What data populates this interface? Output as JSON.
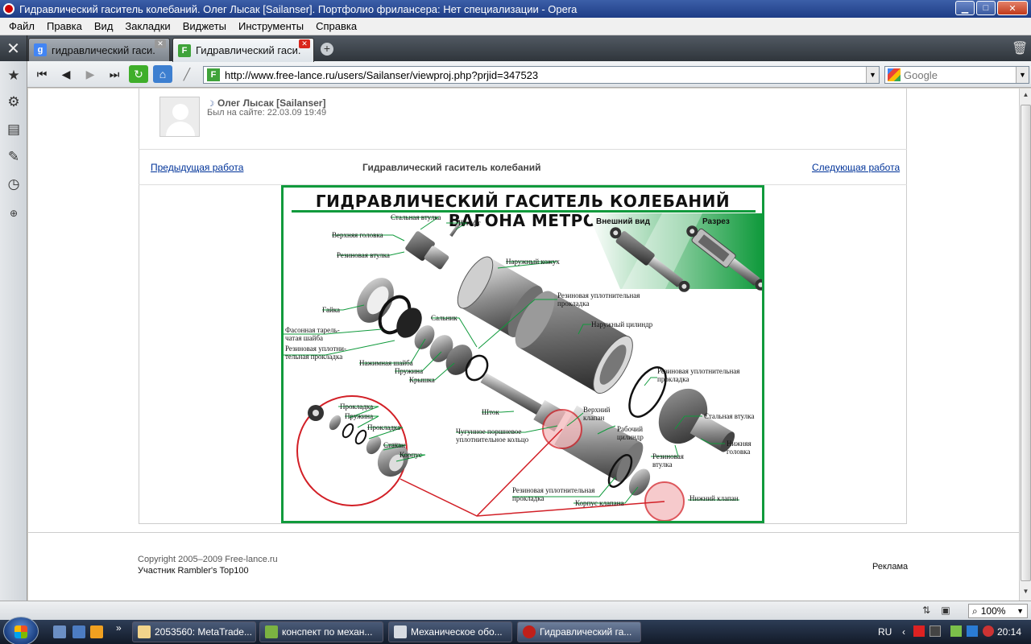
{
  "window": {
    "title": "Гидравлический гаситель колебаний. Олег Лысак [Sailanser]. Портфолио фрилансера: Нет специализации - Opera",
    "min_icon": "minimize-icon",
    "max_icon": "maximize-icon",
    "close_icon": "close-icon"
  },
  "menu": {
    "file": "Файл",
    "edit": "Правка",
    "view": "Вид",
    "bookmarks": "Закладки",
    "widgets": "Виджеты",
    "tools": "Инструменты",
    "help": "Справка"
  },
  "tabs": [
    {
      "label": "гидравлический гаси...",
      "favicon": "google-icon",
      "active": false
    },
    {
      "label": "Гидравлический гаси...",
      "favicon": "free-lance-icon",
      "active": true
    }
  ],
  "address": {
    "url": "http://www.free-lance.ru/users/Sailanser/viewproj.php?prjid=347523",
    "search_placeholder": "Google"
  },
  "profile": {
    "name": "Олег Лысак [Sailanser]",
    "last_seen": "Был на сайте: 22.03.09 19:49"
  },
  "nav": {
    "prev": "Предыдущая работа",
    "title": "Гидравлический гаситель колебаний",
    "next": "Следующая работа"
  },
  "poster": {
    "title": "ГИДРАВЛИЧЕСКИЙ ГАСИТЕЛЬ КОЛЕБАНИЙ ВАГОНА МЕТРО",
    "external_view": "Внешний вид",
    "section": "Разрез",
    "labels": {
      "steel_bushing_top": "Стальная втулка",
      "pin": "Штифт",
      "top_head": "Верхняя головка",
      "rubber_bushing_top": "Резиновая втулка",
      "outer_casing": "Наружный кожух",
      "rubber_gasket_1a": "Резиновая уплотнительная",
      "rubber_gasket_1b": "прокладка",
      "outer_cylinder": "Наружный цилиндр",
      "nut": "Гайка",
      "seal": "Сальник",
      "washer_1": "Фасонная тарель-",
      "washer_2": "чатая шайба",
      "rubber_gasket_2a": "Резиновая уплотни-",
      "rubber_gasket_2b": "тельная прокладка",
      "pressure_washer": "Нажимная шайба",
      "spring": "Пружина",
      "cover": "Крышка",
      "rubber_gasket_3a": "Резиновая уплотнительная",
      "rubber_gasket_3b": "прокладка",
      "rod": "Шток",
      "upper_valve_1": "Верхний",
      "upper_valve_2": "клапан",
      "piston_ring_1": "Чугунное поршневое",
      "piston_ring_2": "уплотнительное кольцо",
      "work_cyl_1": "Рабочий",
      "work_cyl_2": "цилиндр",
      "steel_bushing_bottom": "Стальная втулка",
      "bottom_head_1": "Нижняя",
      "bottom_head_2": "головка",
      "rubber_bushing_bottom_1": "Резиновая",
      "rubber_bushing_bottom_2": "втулка",
      "rubber_gasket_4a": "Резиновая уплотнительная",
      "rubber_gasket_4b": "прокладка",
      "valve_body": "Корпус клапана",
      "lower_valve": "Нижний клапан",
      "d_gasket_1": "Прокладка",
      "d_spring": "Пружина",
      "d_gasket_2": "Прокладка",
      "d_cup": "Стакан",
      "d_body": "Корпус"
    }
  },
  "footer": {
    "copyright": "Copyright 2005–2009 Free-lance.ru",
    "rambler": "Участник Rambler's Top100",
    "ads": "Реклама"
  },
  "status": {
    "zoom": "100%"
  },
  "taskbar": {
    "tasks": [
      {
        "label": "2053560: MetaTrade...",
        "active": false
      },
      {
        "label": "конспект по механ...",
        "active": false
      },
      {
        "label": "Механическое обо...",
        "active": false
      },
      {
        "label": "Гидравлический га...",
        "active": true
      }
    ],
    "lang": "RU",
    "time": "20:14"
  },
  "colors": {
    "poster_green": "#109a3c",
    "callout_red": "#d21f26",
    "link_blue": "#003399"
  }
}
